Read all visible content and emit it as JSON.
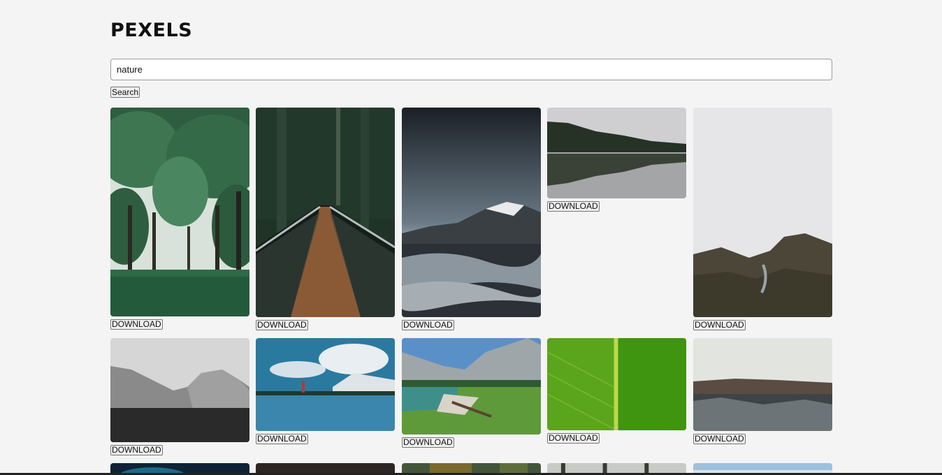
{
  "brand": {
    "logo": "PEXELS"
  },
  "search": {
    "value": "nature",
    "placeholder": "",
    "button_label": "Search"
  },
  "download_label": "DOWNLOAD",
  "photos": [
    {
      "name": "green-park-trees"
    },
    {
      "name": "forest-suspension-bridge"
    },
    {
      "name": "starry-mountain-river"
    },
    {
      "name": "misty-lake-reflection"
    },
    {
      "name": "foggy-forest-road"
    },
    {
      "name": "black-white-mountains"
    },
    {
      "name": "person-lake-reflection"
    },
    {
      "name": "alpine-lake-meadow"
    },
    {
      "name": "green-leaf-closeup"
    },
    {
      "name": "snowy-forest-hill"
    },
    {
      "name": "aurora-sky"
    },
    {
      "name": "dark-interior"
    },
    {
      "name": "autumn-forest"
    },
    {
      "name": "birch-forest"
    },
    {
      "name": "blue-sky-landscape"
    }
  ]
}
